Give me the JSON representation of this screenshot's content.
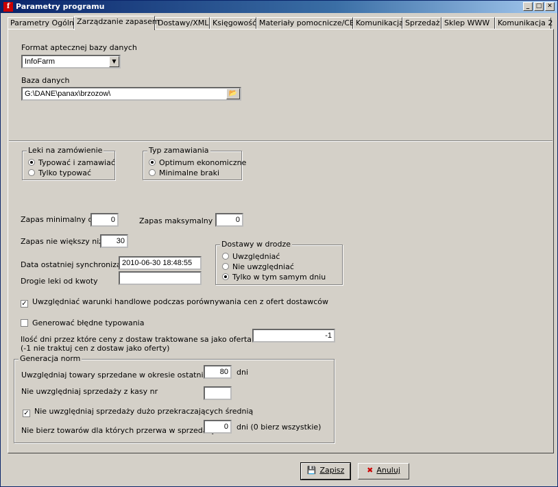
{
  "window": {
    "title": "Parametry programu"
  },
  "tabs": [
    {
      "label": "Parametry Ogólne"
    },
    {
      "label": "Zarządzanie zapasem"
    },
    {
      "label": "Dostawy/XML"
    },
    {
      "label": "Księgowość"
    },
    {
      "label": "Materiały pomocnicze/CBT"
    },
    {
      "label": "Komunikacja"
    },
    {
      "label": "Sprzedaż"
    },
    {
      "label": "Sklep  WWW"
    },
    {
      "label": "Komunikacja 2"
    }
  ],
  "format": {
    "label": "Format aptecznej bazy danych",
    "value": "InfoFarm"
  },
  "db": {
    "label": "Baza danych",
    "value": "G:\\DANE\\panax\\brzozow\\"
  },
  "leki": {
    "caption": "Leki na zamówienie",
    "options": [
      "Typować i zamawiać",
      "Tylko typować"
    ],
    "selected": 0
  },
  "typ": {
    "caption": "Typ zamawiania",
    "options": [
      "Optimum ekonomiczne",
      "Minimalne braki"
    ],
    "selected": 0
  },
  "zapas": {
    "min_label": "Zapas minimalny dni",
    "min_value": "0",
    "max_label": "Zapas maksymalny dni",
    "max_value": "0",
    "nie_wiekszy_label": "Zapas nie większy niż",
    "nie_wiekszy_value": "30"
  },
  "sync": {
    "label": "Data ostatniej synchronizacji",
    "value": "2010-06-30 18:48:55"
  },
  "drogie": {
    "label": "Drogie leki od kwoty",
    "value": ""
  },
  "dostawy": {
    "caption": "Dostawy w drodze",
    "options": [
      "Uwzględniać",
      "Nie uwzględniać",
      "Tylko w tym samym dniu"
    ],
    "selected": 2
  },
  "warunki": {
    "label": "Uwzględniać warunki handlowe podczas porównywania cen z ofert dostawców",
    "checked": true
  },
  "bledne": {
    "label": "Generować błędne typowania",
    "checked": false
  },
  "ilosc": {
    "label1": "Ilość dni przez które ceny z dostaw traktowane sa jako oferta",
    "label2": "(-1 nie traktuj cen z dostaw jako oferty)",
    "value": "-1"
  },
  "normy": {
    "caption": "Generacja norm",
    "okres_label": "Uwzględniaj towary sprzedane w okresie ostatnich",
    "okres_value": "80",
    "okres_unit": "dni",
    "kasy_label": "Nie uwzględniaj sprzedaży z kasy nr",
    "kasy_value": "",
    "srednia_label": "Nie uwzględniaj sprzedaży dużo przekraczających średnią",
    "srednia_checked": true,
    "przerwa_label": "Nie bierz towarów dla których przerwa w sprzedaży  >",
    "przerwa_value": "0",
    "przerwa_unit": "dni (0 bierz wszystkie)"
  },
  "buttons": {
    "save": "Zapisz",
    "cancel": "Anuluj"
  }
}
